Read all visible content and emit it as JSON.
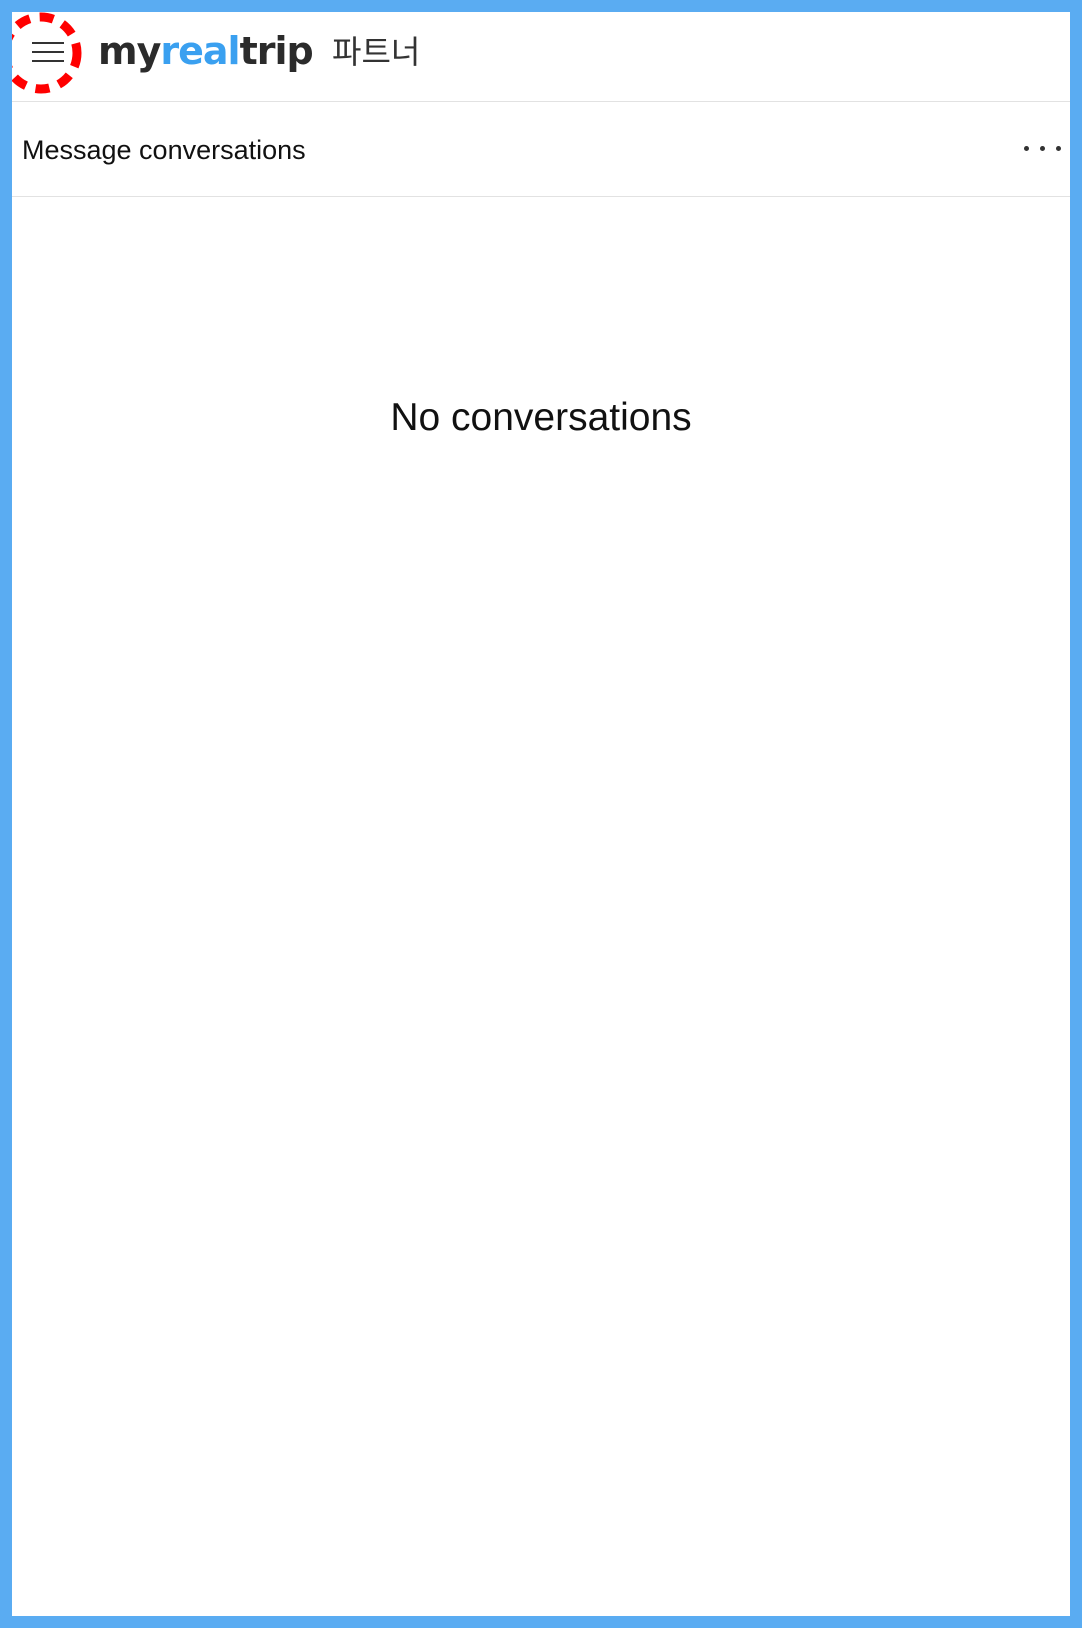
{
  "header": {
    "menu_icon": "hamburger-menu-icon",
    "logo": {
      "part1": "my",
      "part2": "real",
      "part3": "trip"
    },
    "partner_label": "파트너",
    "colors": {
      "logo_dark": "#2b2b2b",
      "logo_blue": "#3aa0f0",
      "highlight": "#ff0000"
    }
  },
  "subheader": {
    "title": "Message conversations",
    "more_icon": "more-dots-icon"
  },
  "main": {
    "empty_message": "No conversations"
  },
  "colors": {
    "frame_border": "#5aacf2",
    "background": "#ffffff",
    "divider": "#e2e2e2"
  }
}
